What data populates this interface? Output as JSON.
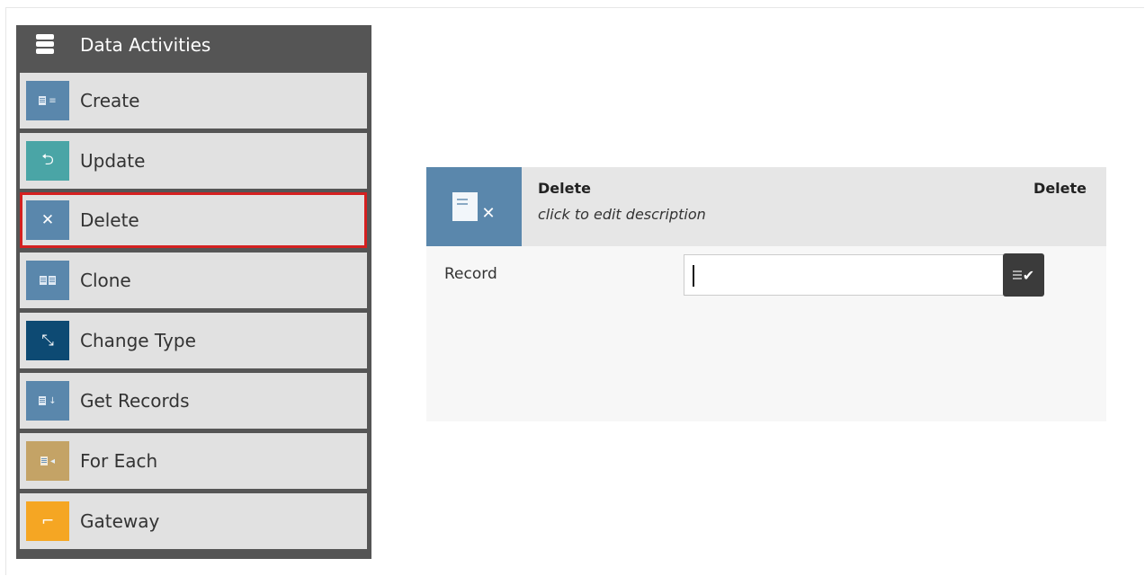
{
  "palette": {
    "title": "Data Activities",
    "items": [
      {
        "label": "Create",
        "color": "#5a87ac",
        "icon": "create-record-icon"
      },
      {
        "label": "Update",
        "color": "#4aa5a6",
        "icon": "update-record-icon"
      },
      {
        "label": "Delete",
        "color": "#5a87ac",
        "icon": "delete-record-icon",
        "selected": true
      },
      {
        "label": "Clone",
        "color": "#5a87ac",
        "icon": "clone-record-icon"
      },
      {
        "label": "Change Type",
        "color": "#0d4a73",
        "icon": "change-type-icon"
      },
      {
        "label": "Get Records",
        "color": "#5a87ac",
        "icon": "get-records-icon"
      },
      {
        "label": "For Each",
        "color": "#c4a366",
        "icon": "for-each-icon"
      },
      {
        "label": "Gateway",
        "color": "#f5a623",
        "icon": "gateway-icon"
      }
    ]
  },
  "panel": {
    "name": "Delete",
    "description": "click to edit description",
    "type": "Delete",
    "tile_icon": "delete-record-icon",
    "field": {
      "label": "Record",
      "value": "",
      "button_icon": "select-record-icon"
    }
  },
  "colors": {
    "selection_border": "#d42020",
    "palette_bg": "#555555"
  }
}
